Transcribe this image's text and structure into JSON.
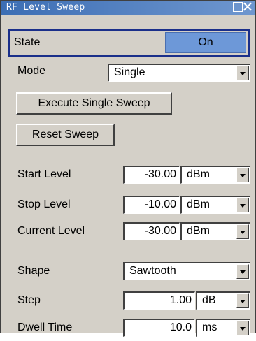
{
  "window": {
    "title": "RF Level Sweep"
  },
  "state": {
    "label": "State",
    "value": "On"
  },
  "mode": {
    "label": "Mode",
    "value": "Single"
  },
  "buttons": {
    "execute": "Execute Single Sweep",
    "reset": "Reset Sweep"
  },
  "levels": [
    {
      "label": "Start Level",
      "value": "-30.00",
      "unit": "dBm"
    },
    {
      "label": "Stop Level",
      "value": "-10.00",
      "unit": "dBm"
    },
    {
      "label": "Current Level",
      "value": "-30.00",
      "unit": "dBm"
    }
  ],
  "shape": {
    "label": "Shape",
    "value": "Sawtooth"
  },
  "step": {
    "label": "Step",
    "value": "1.00",
    "unit": "dB"
  },
  "dwell": {
    "label": "Dwell Time",
    "value": "10.0",
    "unit": "ms"
  },
  "icons": {
    "maximize": "maximize-icon",
    "close": "close-icon"
  }
}
